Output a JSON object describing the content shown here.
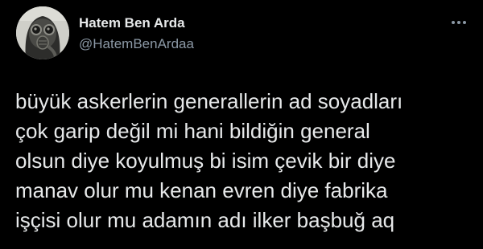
{
  "tweet": {
    "author": {
      "display_name": "Hatem Ben Arda",
      "handle": "@HatemBenArdaa",
      "avatar_icon": "gas-mask-avatar"
    },
    "more_icon": "more-dots-icon",
    "text_lines": [
      "büyük askerlerin generallerin ad soyadları",
      "çok garip değil mi hani bildiğin general",
      "olsun diye koyulmuş bi isim çevik bir diye",
      "manav olur mu kenan evren diye fabrika",
      "işçisi olur mu adamın adı ilker başbuğ aq"
    ],
    "colors": {
      "background": "#000000",
      "text_primary": "#e7e9ea",
      "text_secondary": "#8b98a5"
    }
  }
}
